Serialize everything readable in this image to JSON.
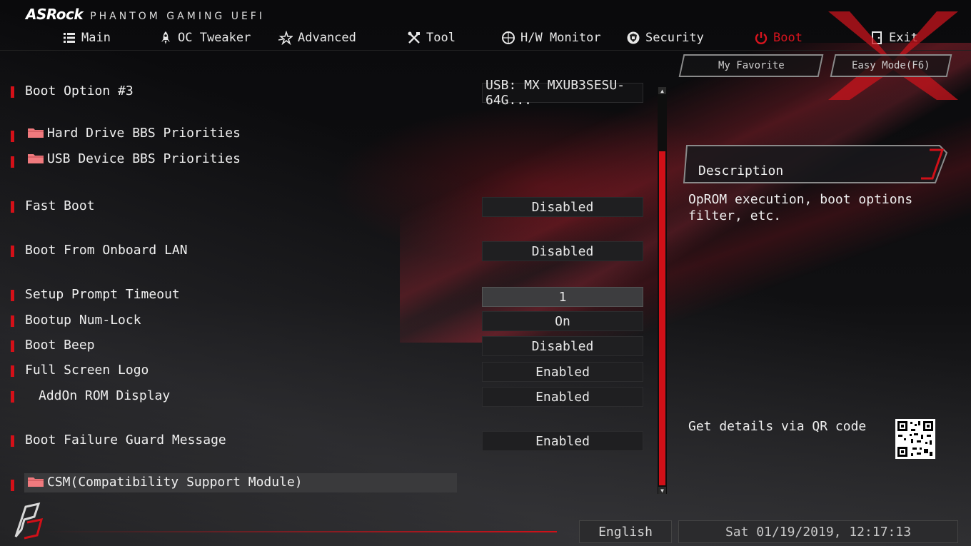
{
  "header": {
    "brand": "ASRock",
    "product": "PHANTOM GAMING UEFI"
  },
  "nav": {
    "tabs": [
      {
        "label": "Main",
        "icon": "list-icon"
      },
      {
        "label": "OC Tweaker",
        "icon": "rocket-icon"
      },
      {
        "label": "Advanced",
        "icon": "star-icon"
      },
      {
        "label": "Tool",
        "icon": "tools-icon"
      },
      {
        "label": "H/W Monitor",
        "icon": "monitor-icon"
      },
      {
        "label": "Security",
        "icon": "shield-icon"
      },
      {
        "label": "Boot",
        "icon": "power-icon",
        "active": true
      },
      {
        "label": "Exit",
        "icon": "exit-icon"
      }
    ],
    "active_color": "#d8141e"
  },
  "favorites": {
    "my_favorite": "My Favorite",
    "easy_mode": "Easy Mode(F6)"
  },
  "settings": [
    {
      "label": "Boot Option #3",
      "value": "USB: MX MXUB3SESU-64G..."
    },
    {
      "label": "Hard Drive BBS Priorities",
      "folder": true
    },
    {
      "label": "USB Device BBS Priorities",
      "folder": true
    },
    {
      "label": "Fast Boot",
      "value": "Disabled"
    },
    {
      "label": "Boot From Onboard LAN",
      "value": "Disabled"
    },
    {
      "label": "Setup Prompt Timeout",
      "value": "1"
    },
    {
      "label": "Bootup Num-Lock",
      "value": "On"
    },
    {
      "label": "Boot Beep",
      "value": "Disabled"
    },
    {
      "label": "Full Screen Logo",
      "value": "Enabled"
    },
    {
      "label": "AddOn ROM Display",
      "value": "Enabled"
    },
    {
      "label": "Boot Failure Guard Message",
      "value": "Enabled"
    },
    {
      "label": "CSM(Compatibility Support Module)",
      "folder": true,
      "selected": true
    }
  ],
  "description": {
    "title": "Description",
    "text": "OpROM execution, boot options filter, etc.",
    "qr_label": "Get details via QR code"
  },
  "footer": {
    "language": "English",
    "datetime": "Sat 01/19/2019, 12:17:13"
  },
  "colors": {
    "accent": "#d01018",
    "text": "#f0f0f0",
    "field_bg": "#1f1f21"
  }
}
